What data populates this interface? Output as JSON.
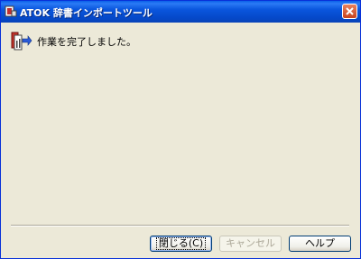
{
  "window": {
    "title": "ATOK 辞書インポートツール"
  },
  "message": {
    "text": "作業を完了しました。",
    "icon": "dictionary-import-icon"
  },
  "buttons": {
    "close": "閉じる(C)",
    "cancel": "キャンセル",
    "help": "ヘルプ"
  },
  "colors": {
    "titlebar": "#0a56dd",
    "background": "#ece9d8",
    "close_button": "#c8441e"
  }
}
